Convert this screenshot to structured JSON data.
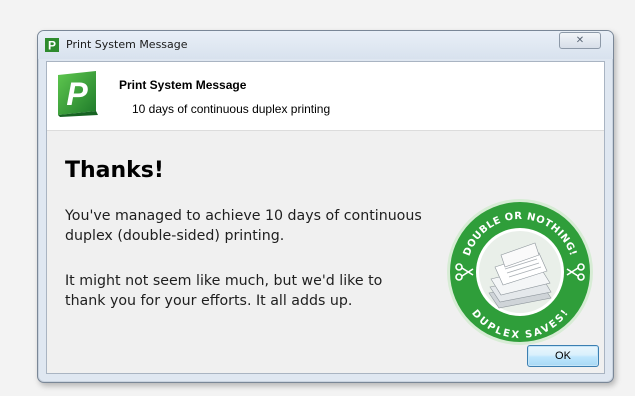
{
  "window": {
    "title": "Print System Message",
    "close_glyph": "✕"
  },
  "header": {
    "title": "Print System Message",
    "subtitle": "10 days of continuous duplex printing"
  },
  "body": {
    "heading": "Thanks!",
    "paragraph1": "You've managed to achieve 10 days of continuous duplex (double-sided) printing.",
    "paragraph2": "It might not seem like much, but we'd like to thank you for your efforts. It all adds up."
  },
  "badge": {
    "top_text": "DOUBLE OR NOTHING!",
    "bottom_text": "DUPLEX SAVES!",
    "color": "#2f9e3a"
  },
  "buttons": {
    "ok_label": "OK"
  },
  "icons": {
    "app": "papercut-logo-icon",
    "close": "close-icon",
    "scissors": "scissors-icon"
  }
}
